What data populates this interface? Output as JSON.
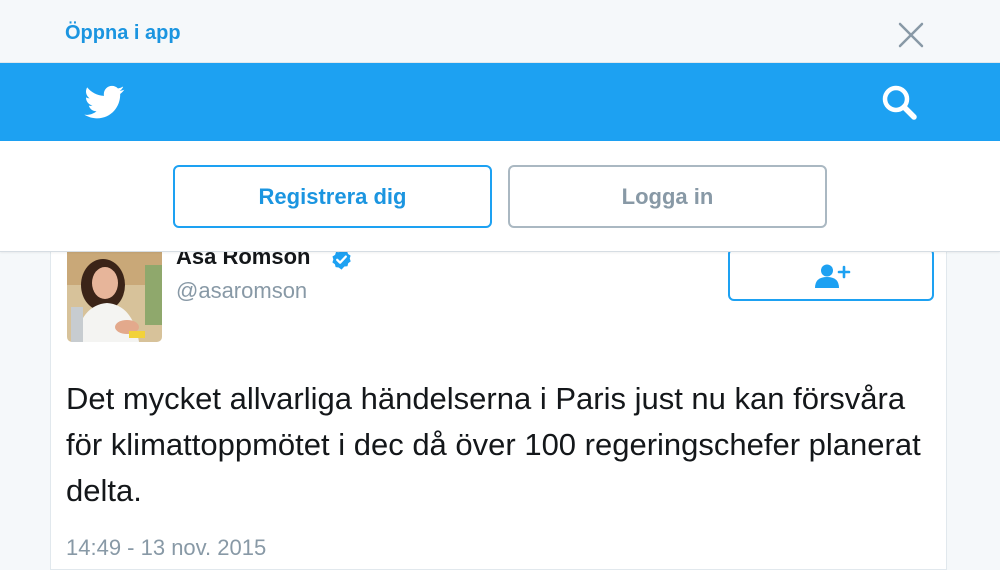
{
  "topbar": {
    "open_app_label": "Öppna i app",
    "close_icon": "close-icon"
  },
  "navbar": {
    "logo_icon": "twitter-bird-icon",
    "search_icon": "search-icon"
  },
  "auth": {
    "signup_label": "Registrera dig",
    "login_label": "Logga in"
  },
  "tweet": {
    "author_name": "Åsa Romson",
    "author_handle": "@asaromson",
    "verified_icon": "verified-badge-icon",
    "follow_icon": "follow-user-icon",
    "text": "Det mycket allvarliga händelserna i Paris just nu kan försvåra för klimattoppmötet i dec då över 100 regeringschefer planerat delta.",
    "timestamp": "14:49 - 13 nov. 2015"
  },
  "colors": {
    "brand": "#1da1f2",
    "link": "#1b95e0",
    "muted": "#8899a6",
    "text": "#14171a",
    "background": "#f5f8fa"
  }
}
